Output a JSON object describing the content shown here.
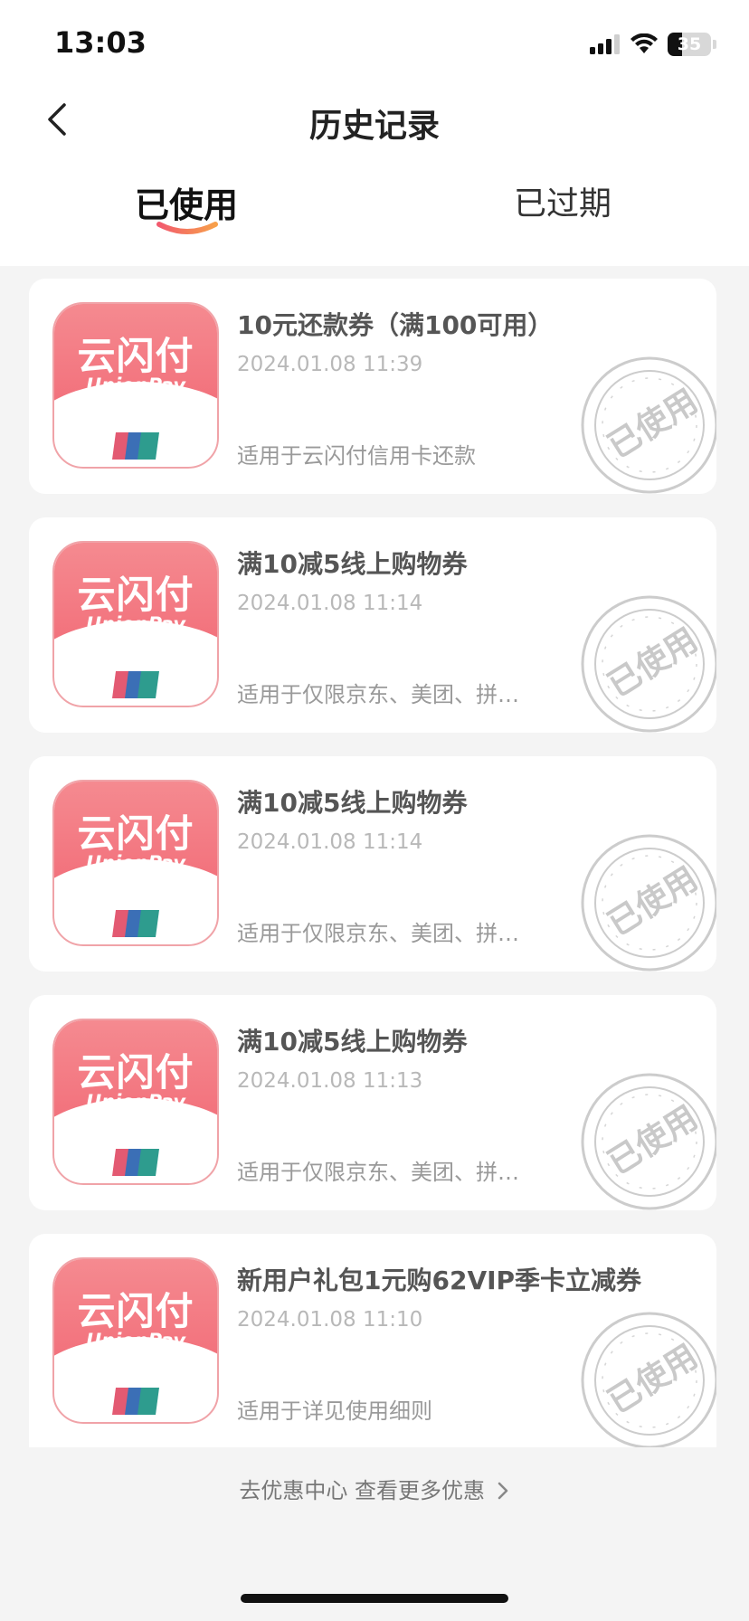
{
  "status_bar": {
    "time": "13:03",
    "battery_level": "35",
    "icons": [
      "signal-icon",
      "wifi-icon",
      "battery-icon"
    ]
  },
  "header": {
    "title": "历史记录",
    "back_icon": "chevron-left-icon"
  },
  "tabs": [
    {
      "label": "已使用",
      "active": true
    },
    {
      "label": "已过期",
      "active": false
    }
  ],
  "logo": {
    "cn": "云闪付",
    "en": "UnionPay"
  },
  "stamp_label": "已使用",
  "coupons": [
    {
      "title": "10元还款券（满100可用）",
      "time": "2024.01.08 11:39",
      "desc": "适用于云闪付信用卡还款"
    },
    {
      "title": "满10减5线上购物券",
      "time": "2024.01.08 11:14",
      "desc": "适用于仅限京东、美团、拼…"
    },
    {
      "title": "满10减5线上购物券",
      "time": "2024.01.08 11:14",
      "desc": "适用于仅限京东、美团、拼…"
    },
    {
      "title": "满10减5线上购物券",
      "time": "2024.01.08 11:13",
      "desc": "适用于仅限京东、美团、拼…"
    },
    {
      "title": "新用户礼包1元购62VIP季卡立减券",
      "time": "2024.01.08 11:10",
      "desc": "适用于详见使用细则"
    }
  ],
  "footer": {
    "more_link": "去优惠中心 查看更多优惠",
    "chevron_icon": "chevron-right-icon"
  },
  "colors": {
    "accent": "#f26f7a",
    "tab_underline_start": "#f25a6e",
    "tab_underline_end": "#f7a04a"
  }
}
